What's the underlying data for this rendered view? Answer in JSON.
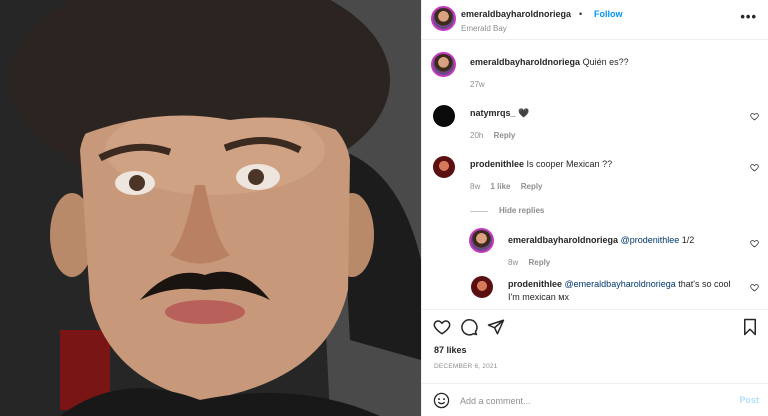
{
  "post": {
    "username": "emeraldbayharoldnoriega",
    "dot": "•",
    "follow_label": "Follow",
    "location": "Emerald Bay",
    "more_label": "•••",
    "caption": {
      "username": "emeraldbayharoldnoriega",
      "text": "Quién es??",
      "time": "27w"
    },
    "likes": "87 likes",
    "date": "DECEMBER 6, 2021"
  },
  "comments": [
    {
      "username": "natymrqs_",
      "text": "🖤",
      "time": "20h",
      "reply_label": "Reply"
    },
    {
      "username": "prodenithlee",
      "text": "Is cooper Mexican ??",
      "time": "8w",
      "likes_label": "1 like",
      "reply_label": "Reply"
    }
  ],
  "hide_replies_label": "Hide replies",
  "replies": [
    {
      "username": "emeraldbayharoldnoriega",
      "mention": "@prodenithlee",
      "text": "1/2",
      "time": "8w",
      "reply_label": "Reply"
    },
    {
      "username": "prodenithlee",
      "mention": "@emeraldbayharoldnoriega",
      "text": "that's so cool I'm mexican",
      "text_line2": "",
      "suffix": "мх"
    }
  ],
  "add_comment": {
    "placeholder": "Add a comment...",
    "post_label": "Post"
  },
  "icons": {
    "like": "heart-icon",
    "comment": "comment-icon",
    "share": "share-icon",
    "save": "bookmark-icon",
    "emoji": "emoji-icon"
  },
  "colors": {
    "accent": "#0095f6",
    "post_disabled": "#b2dffc",
    "meta": "#8e8e8e",
    "border": "#efefef"
  }
}
